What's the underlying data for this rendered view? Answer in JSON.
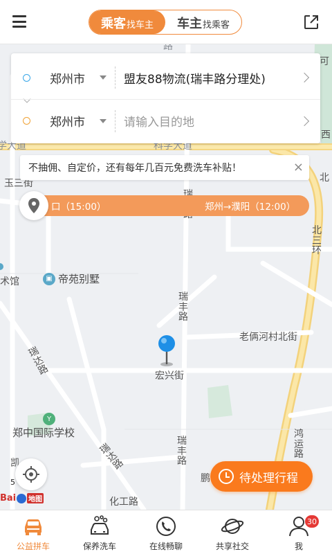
{
  "header": {
    "segment": [
      {
        "main": "乘客",
        "sub": "找车主",
        "active": true
      },
      {
        "main": "车主",
        "sub": "找乘客",
        "active": false
      }
    ]
  },
  "route": {
    "origin": {
      "city": "郑州市",
      "place": "盟友88物流(瑞丰路分理处)"
    },
    "destination": {
      "city": "郑州市",
      "placeholder": "请输入目的地"
    }
  },
  "notice": {
    "text": "不抽佣、自定价，还有每年几百元免费洗车补贴！",
    "close": "×"
  },
  "ticker": {
    "items": [
      "口（15:00）",
      "郑州→濮阳（12:00）"
    ]
  },
  "map": {
    "labels": {
      "science_road_left": "学大道",
      "science_road_right": "科学大道",
      "jade_street": "玉三街",
      "art_hall": "术馆",
      "ruifeng_road_1": "瑞丰路",
      "ruifeng_road_2": "瑞丰路",
      "ruifeng_road_3": "瑞丰路",
      "laoliang_street": "老俩河村北街",
      "hongxing_street": "宏兴街",
      "ruida_road_1": "瑞达路",
      "ruida_road_2": "瑞达路",
      "hongyun_road": "鸿运路",
      "north_3_ring": "北三环",
      "north_edge": "北",
      "west_edge": "西",
      "kai_label": "凯",
      "hua_label": "化工路",
      "top_lu": "路",
      "top_lu_right": "可",
      "bottom_peng": "鹏"
    },
    "pois": [
      {
        "name": "帝苑别墅",
        "icon": "building-icon"
      },
      {
        "name": "郑中国际学校",
        "icon": "school-icon"
      }
    ],
    "scale": "5"
  },
  "logo": {
    "brand": "Bai",
    "suffix": "地图"
  },
  "pending_button": {
    "label": "待处理行程"
  },
  "tabs": [
    {
      "label": "公益拼车",
      "icon": "car-icon",
      "active": true
    },
    {
      "label": "保养洗车",
      "icon": "car-wash-icon",
      "active": false
    },
    {
      "label": "在线畅聊",
      "icon": "phone-icon",
      "active": false
    },
    {
      "label": "共享社交",
      "icon": "planet-icon",
      "active": false
    },
    {
      "label": "我",
      "icon": "person-icon",
      "active": false,
      "badge": "30"
    }
  ],
  "colors": {
    "accent": "#f08a3c",
    "ticker": "#f39a5a",
    "pending": "#fa7a1d",
    "origin_ring": "#37a6e8",
    "destination_ring": "#f0a235",
    "badge": "#e53935"
  }
}
